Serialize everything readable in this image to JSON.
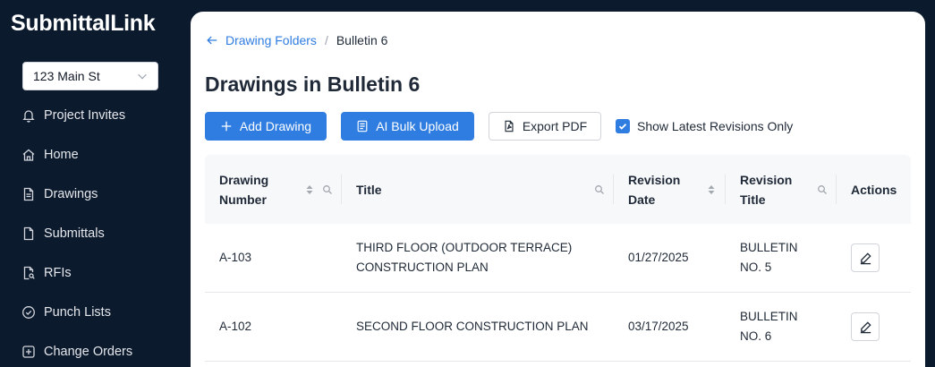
{
  "app": {
    "brand": "SubmittalLink"
  },
  "project_select": {
    "value": "123 Main St"
  },
  "sidebar": {
    "items": [
      {
        "label": "Project Invites",
        "icon": "bell-icon"
      },
      {
        "label": "Home",
        "icon": "home-icon"
      },
      {
        "label": "Drawings",
        "icon": "file-text-icon"
      },
      {
        "label": "Submittals",
        "icon": "file-icon"
      },
      {
        "label": "RFIs",
        "icon": "file-search-icon"
      },
      {
        "label": "Punch Lists",
        "icon": "check-circle-icon"
      },
      {
        "label": "Change Orders",
        "icon": "plus-square-icon"
      }
    ]
  },
  "breadcrumb": {
    "back_label": "Drawing Folders",
    "separator": "/",
    "current": "Bulletin 6"
  },
  "page": {
    "title": "Drawings in Bulletin 6"
  },
  "toolbar": {
    "add_label": "Add Drawing",
    "ai_label": "AI Bulk Upload",
    "pdf_label": "Export PDF",
    "latest_label": "Show Latest Revisions Only",
    "latest_checked": true
  },
  "table": {
    "headers": [
      {
        "line1": "Drawing",
        "line2": "Number"
      },
      {
        "line1": "Title",
        "line2": ""
      },
      {
        "line1": "Revision",
        "line2": "Date"
      },
      {
        "line1": "Revision",
        "line2": "Title"
      },
      {
        "line1": "Actions",
        "line2": ""
      }
    ],
    "rows": [
      {
        "number": "A-103",
        "title_1": "THIRD FLOOR (OUTDOOR TERRACE)",
        "title_2": "CONSTRUCTION PLAN",
        "date": "01/27/2025",
        "rev_1": "BULLETIN",
        "rev_2": "NO. 5"
      },
      {
        "number": "A-102",
        "title_1": "SECOND FLOOR CONSTRUCTION PLAN",
        "title_2": "",
        "date": "03/17/2025",
        "rev_1": "BULLETIN",
        "rev_2": "NO. 6"
      }
    ]
  },
  "colors": {
    "accent": "#2f7de1",
    "sidebar_bg": "#0c1a2e",
    "header_bg": "#f7f8fa"
  }
}
